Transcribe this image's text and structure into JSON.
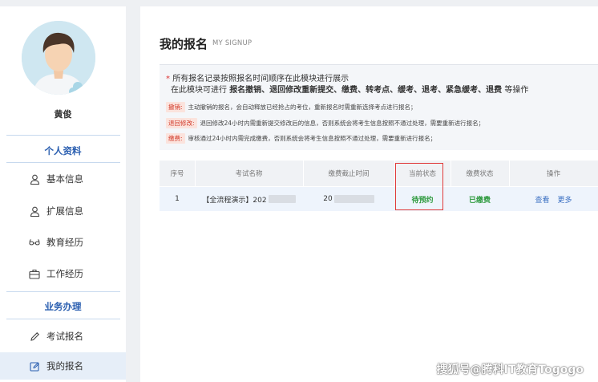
{
  "sidebar": {
    "username": "黄俊",
    "section1_title": "个人资料",
    "section1_items": [
      {
        "label": "基本信息",
        "icon": "user-icon"
      },
      {
        "label": "扩展信息",
        "icon": "user-icon"
      },
      {
        "label": "教育经历",
        "icon": "glasses-icon"
      },
      {
        "label": "工作经历",
        "icon": "briefcase-icon"
      }
    ],
    "section2_title": "业务办理",
    "section2_items": [
      {
        "label": "考试报名",
        "icon": "pencil-icon"
      },
      {
        "label": "我的报名",
        "icon": "edit-document-icon",
        "active": true
      }
    ]
  },
  "main": {
    "title": "我的报名",
    "subtitle": "MY SIGNUP",
    "notice": {
      "star": "*",
      "line1": "所有报名记录按照报名时间顺序在此模块进行展示",
      "line2_prefix": "在此模块可进行",
      "line2_bold": "报名撤销、退回修改重新提交、缴费、转考点、缓考、退考、紧急缓考、退费",
      "line2_suffix": "等操作",
      "rules": [
        {
          "tag": "撤销:",
          "text": "主动撤销的报名，会自动释放已经抢占的考位，重新报名时需重新选择考点进行报名；"
        },
        {
          "tag": "退回修改:",
          "text": "退回修改24小时内需重新提交修改后的信息，否则系统会将考生信息按照不通过处理，需要重新进行报名；"
        },
        {
          "tag": "缴费:",
          "text": "审核通过24小时内需完成缴费，否则系统会将考生信息按照不通过处理，需要重新进行报名；"
        }
      ]
    },
    "table": {
      "headers": [
        "序号",
        "考试名称",
        "缴费截止时间",
        "当前状态",
        "缴费状态",
        "操作"
      ],
      "rows": [
        {
          "index": "1",
          "exam_name": "【全流程演示】202",
          "deadline": "20",
          "status": "待预约",
          "payment_status": "已缴费",
          "actions": [
            "查看",
            "更多"
          ]
        }
      ]
    }
  },
  "watermark": "搜狐号@腾科IT教育Togogo"
}
